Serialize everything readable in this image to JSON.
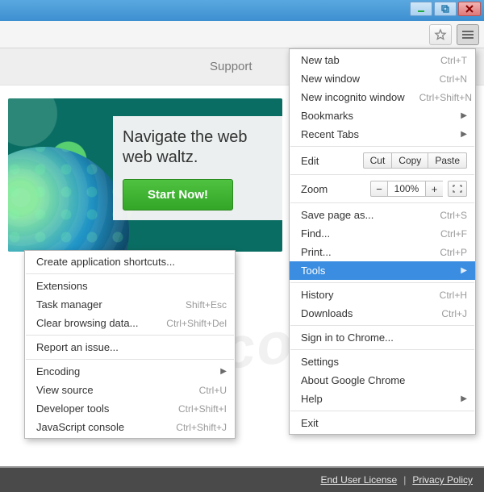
{
  "support_label": "Support",
  "hero": {
    "headline_l1": "Navigate the web",
    "headline_l2": "web waltz.",
    "cta": "Start Now!"
  },
  "footer": {
    "eula": "End User License",
    "privacy": "Privacy Policy"
  },
  "main_menu": {
    "new_tab": "New tab",
    "new_tab_k": "Ctrl+T",
    "new_window": "New window",
    "new_window_k": "Ctrl+N",
    "incognito": "New incognito window",
    "incognito_k": "Ctrl+Shift+N",
    "bookmarks": "Bookmarks",
    "recent_tabs": "Recent Tabs",
    "edit": "Edit",
    "cut": "Cut",
    "copy": "Copy",
    "paste": "Paste",
    "zoom": "Zoom",
    "zoom_value": "100%",
    "save": "Save page as...",
    "save_k": "Ctrl+S",
    "find": "Find...",
    "find_k": "Ctrl+F",
    "print": "Print...",
    "print_k": "Ctrl+P",
    "tools": "Tools",
    "history": "History",
    "history_k": "Ctrl+H",
    "downloads": "Downloads",
    "downloads_k": "Ctrl+J",
    "signin": "Sign in to Chrome...",
    "settings": "Settings",
    "about": "About Google Chrome",
    "help": "Help",
    "exit": "Exit"
  },
  "tools_menu": {
    "create_shortcut": "Create application shortcuts...",
    "extensions": "Extensions",
    "task_manager": "Task manager",
    "task_manager_k": "Shift+Esc",
    "clear_data": "Clear browsing data...",
    "clear_data_k": "Ctrl+Shift+Del",
    "report_issue": "Report an issue...",
    "encoding": "Encoding",
    "view_source": "View source",
    "view_source_k": "Ctrl+U",
    "dev_tools": "Developer tools",
    "dev_tools_k": "Ctrl+Shift+I",
    "js_console": "JavaScript console",
    "js_console_k": "Ctrl+Shift+J"
  }
}
